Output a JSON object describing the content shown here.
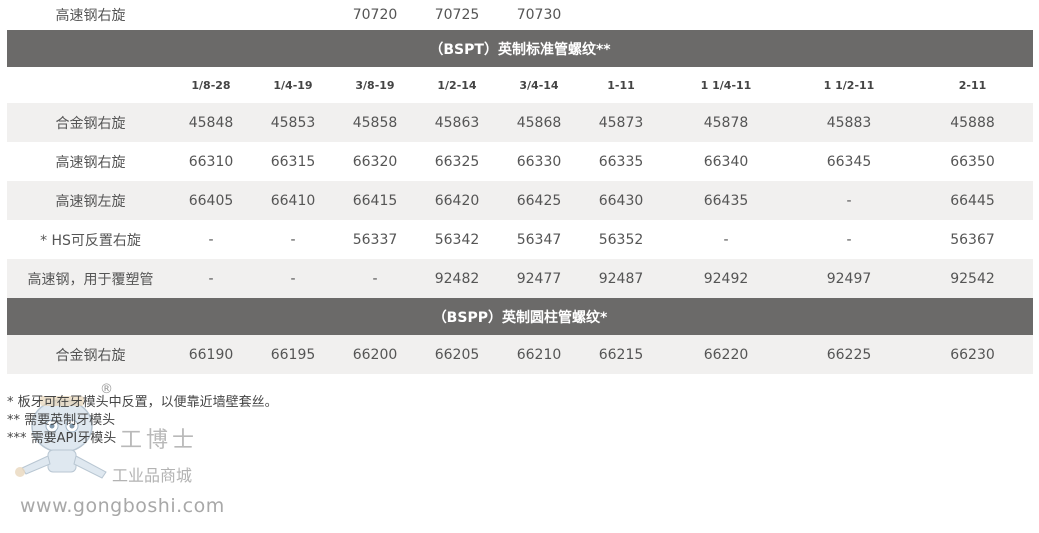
{
  "top_row": {
    "label": "高速钢右旋",
    "values": [
      "",
      "",
      "70720",
      "70725",
      "70730",
      "",
      "",
      "",
      ""
    ]
  },
  "section_bspt": {
    "title": "（BSPT）英制标准管螺纹**",
    "headers": [
      "1/8-28",
      "1/4-19",
      "3/8-19",
      "1/2-14",
      "3/4-14",
      "1-11",
      "1 1/4-11",
      "1 1/2-11",
      "2-11"
    ],
    "rows": [
      {
        "label": "合金钢右旋",
        "values": [
          "45848",
          "45853",
          "45858",
          "45863",
          "45868",
          "45873",
          "45878",
          "45883",
          "45888"
        ]
      },
      {
        "label": "高速钢右旋",
        "values": [
          "66310",
          "66315",
          "66320",
          "66325",
          "66330",
          "66335",
          "66340",
          "66345",
          "66350"
        ]
      },
      {
        "label": "高速钢左旋",
        "values": [
          "66405",
          "66410",
          "66415",
          "66420",
          "66425",
          "66430",
          "66435",
          "-",
          "66445"
        ]
      },
      {
        "label": "* HS可反置右旋",
        "values": [
          "-",
          "-",
          "56337",
          "56342",
          "56347",
          "56352",
          "-",
          "-",
          "56367"
        ]
      },
      {
        "label": "高速钢，用于覆塑管",
        "values": [
          "-",
          "-",
          "-",
          "92482",
          "92477",
          "92487",
          "92492",
          "92497",
          "92542"
        ]
      }
    ]
  },
  "section_bspp": {
    "title": "（BSPP）英制圆柱管螺纹*",
    "rows": [
      {
        "label": "合金钢右旋",
        "values": [
          "66190",
          "66195",
          "66200",
          "66205",
          "66210",
          "66215",
          "66220",
          "66225",
          "66230"
        ]
      }
    ]
  },
  "notes": [
    "* 板牙可在牙模头中反置，以便靠近墙壁套丝。",
    "** 需要英制牙模头",
    "*** 需要API牙模头"
  ],
  "watermark": {
    "brand": "工博士",
    "registered": "®",
    "subtitle": "工业品商城",
    "url": "www.gongboshi.com"
  },
  "colors": {
    "band": "#6b6a69",
    "row_alt": "#f1f0ef",
    "text": "#555555"
  }
}
